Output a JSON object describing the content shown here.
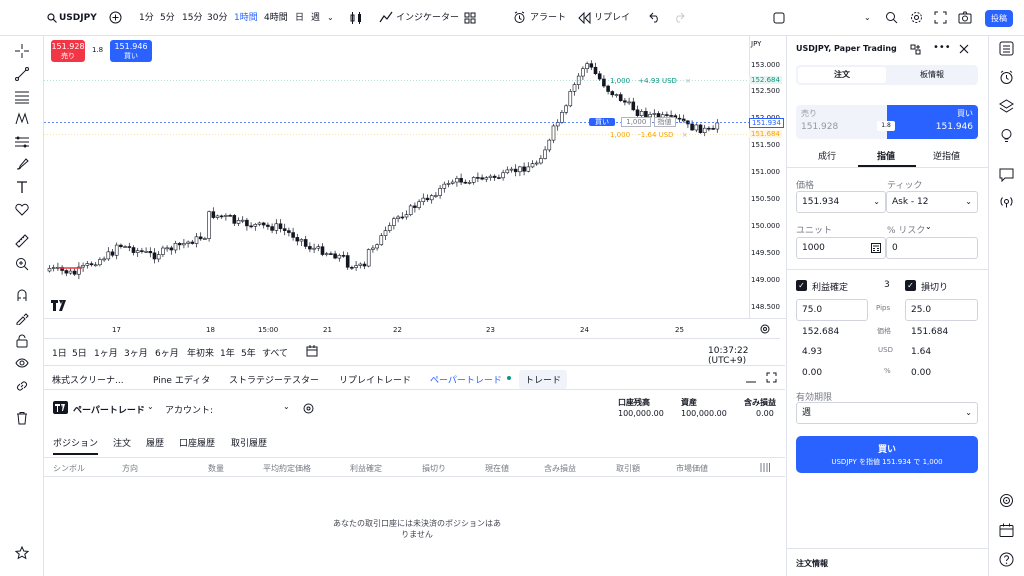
{
  "topbar": {
    "symbol": "USDJPY",
    "intervals": [
      "1分",
      "5分",
      "15分",
      "30分",
      "1時間",
      "4時間",
      "日",
      "週"
    ],
    "active_interval": "1時間",
    "indicators": "インジケーター",
    "alert": "アラート",
    "replay": "リプレイ",
    "publish": "投稿"
  },
  "chart": {
    "sell_price": "151.928",
    "sell_label": "売り",
    "spread": "1.8",
    "buy_price": "151.946",
    "buy_label": "買い",
    "currency": "JPY",
    "price_ticks": [
      "153.000",
      "152.500",
      "152.000",
      "151.500",
      "151.000",
      "150.500",
      "150.000",
      "149.500",
      "149.000",
      "148.500"
    ],
    "date_ticks": [
      "17",
      "18",
      "15:00",
      "21",
      "22",
      "23",
      "24",
      "25"
    ],
    "tp_qty": "1,000",
    "tp_pnl": "+4.93 USD",
    "tp_price": "152.684",
    "entry_side": "買い",
    "entry_qty": "1,000",
    "entry_type": "指値",
    "entry_price": "151.934",
    "sl_qty": "1,000",
    "sl_pnl": "-1.64 USD",
    "sl_price": "151.684",
    "colors": {
      "up": "#ffffff",
      "down": "#131722",
      "accent": "#2962ff",
      "tp": "#089981",
      "sl": "#f7a600"
    }
  },
  "range": {
    "items": [
      "1日",
      "5日",
      "1ヶ月",
      "3ヶ月",
      "6ヶ月",
      "年初来",
      "1年",
      "5年",
      "すべて"
    ],
    "time": "10:37:22 (UTC+9)"
  },
  "bottom": {
    "tabs": [
      "株式スクリーナ...",
      "Pine エディタ",
      "ストラテジーテスター",
      "リプレイトレード",
      "ペーパートレード",
      "トレード"
    ],
    "broker": "ペーパートレード",
    "account_label": "アカウント:",
    "stats": [
      {
        "label": "口座残高",
        "value": "100,000.00"
      },
      {
        "label": "資産",
        "value": "100,000.00"
      },
      {
        "label": "含み損益",
        "value": "0.00"
      }
    ],
    "subtabs": [
      "ポジション",
      "注文",
      "履歴",
      "口座履歴",
      "取引履歴"
    ],
    "columns": [
      "シンボル",
      "方向",
      "数量",
      "平均約定価格",
      "利益確定",
      "損切り",
      "現在値",
      "含み損益",
      "取引額",
      "市場価値"
    ],
    "empty_line1": "あなたの取引口座には未決済のポジションはあ",
    "empty_line2": "りません"
  },
  "order": {
    "title": "USDJPY, Paper Trading",
    "tab_order": "注文",
    "tab_book": "板情報",
    "sell_label": "売り",
    "sell_price": "151.928",
    "spread": "1.8",
    "buy_label": "買い",
    "buy_price": "151.946",
    "types": [
      "成行",
      "指値",
      "逆指値"
    ],
    "price_label": "価格",
    "price_value": "151.934",
    "tick_label": "ティック",
    "tick_value": "Ask - 12",
    "unit_label": "ユニット",
    "unit_value": "1000",
    "risk_label": "% リスク",
    "risk_value": "0",
    "tp_label": "利益確定",
    "count": "3",
    "sl_label": "損切り",
    "rows": [
      {
        "mid": "Pips",
        "left": "75.0",
        "right": "25.0"
      },
      {
        "mid": "価格",
        "left": "152.684",
        "right": "151.684"
      },
      {
        "mid": "USD",
        "left": "4.93",
        "right": "1.64"
      },
      {
        "mid": "%",
        "left": "0.00",
        "right": "0.00"
      }
    ],
    "expiry_label": "有効期限",
    "expiry_value": "週",
    "submit_label": "買い",
    "submit_sub": "USDJPY を指値 151.934 で 1,000",
    "order_info": "注文情報"
  }
}
